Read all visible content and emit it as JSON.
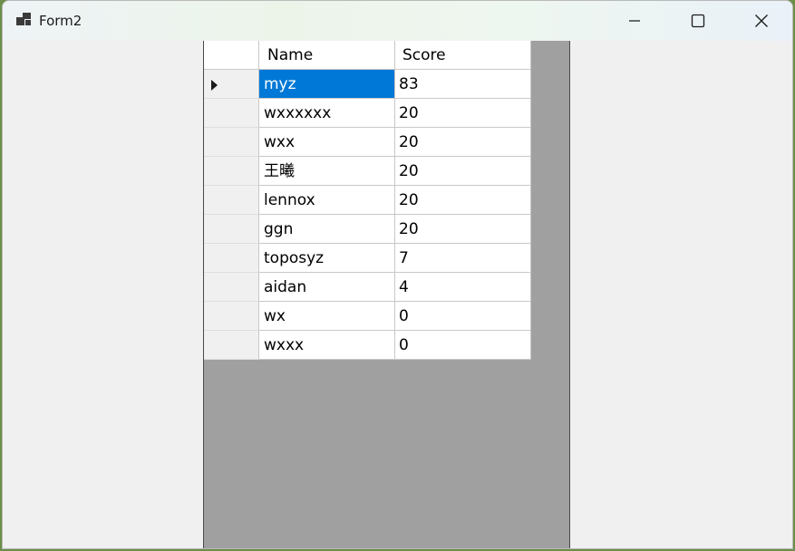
{
  "window": {
    "title": "Form2"
  },
  "icons": {
    "app": "form-app-icon",
    "minimize": "minimize-icon",
    "maximize": "maximize-icon",
    "close": "close-icon",
    "row_indicator": "row-pointer-icon"
  },
  "colors": {
    "selection": "#0078d7",
    "grid_background": "#a0a0a0"
  },
  "grid": {
    "columns": [
      "Name",
      "Score"
    ],
    "current_row": 0,
    "rows": [
      {
        "name": "myz",
        "score": "83"
      },
      {
        "name": "wxxxxxx",
        "score": "20"
      },
      {
        "name": "wxx",
        "score": "20"
      },
      {
        "name": "王曦",
        "score": "20"
      },
      {
        "name": "lennox",
        "score": "20"
      },
      {
        "name": "ggn",
        "score": "20"
      },
      {
        "name": "toposyz",
        "score": "7"
      },
      {
        "name": "aidan",
        "score": "4"
      },
      {
        "name": "wx",
        "score": "0"
      },
      {
        "name": "wxxx",
        "score": "0"
      }
    ]
  }
}
